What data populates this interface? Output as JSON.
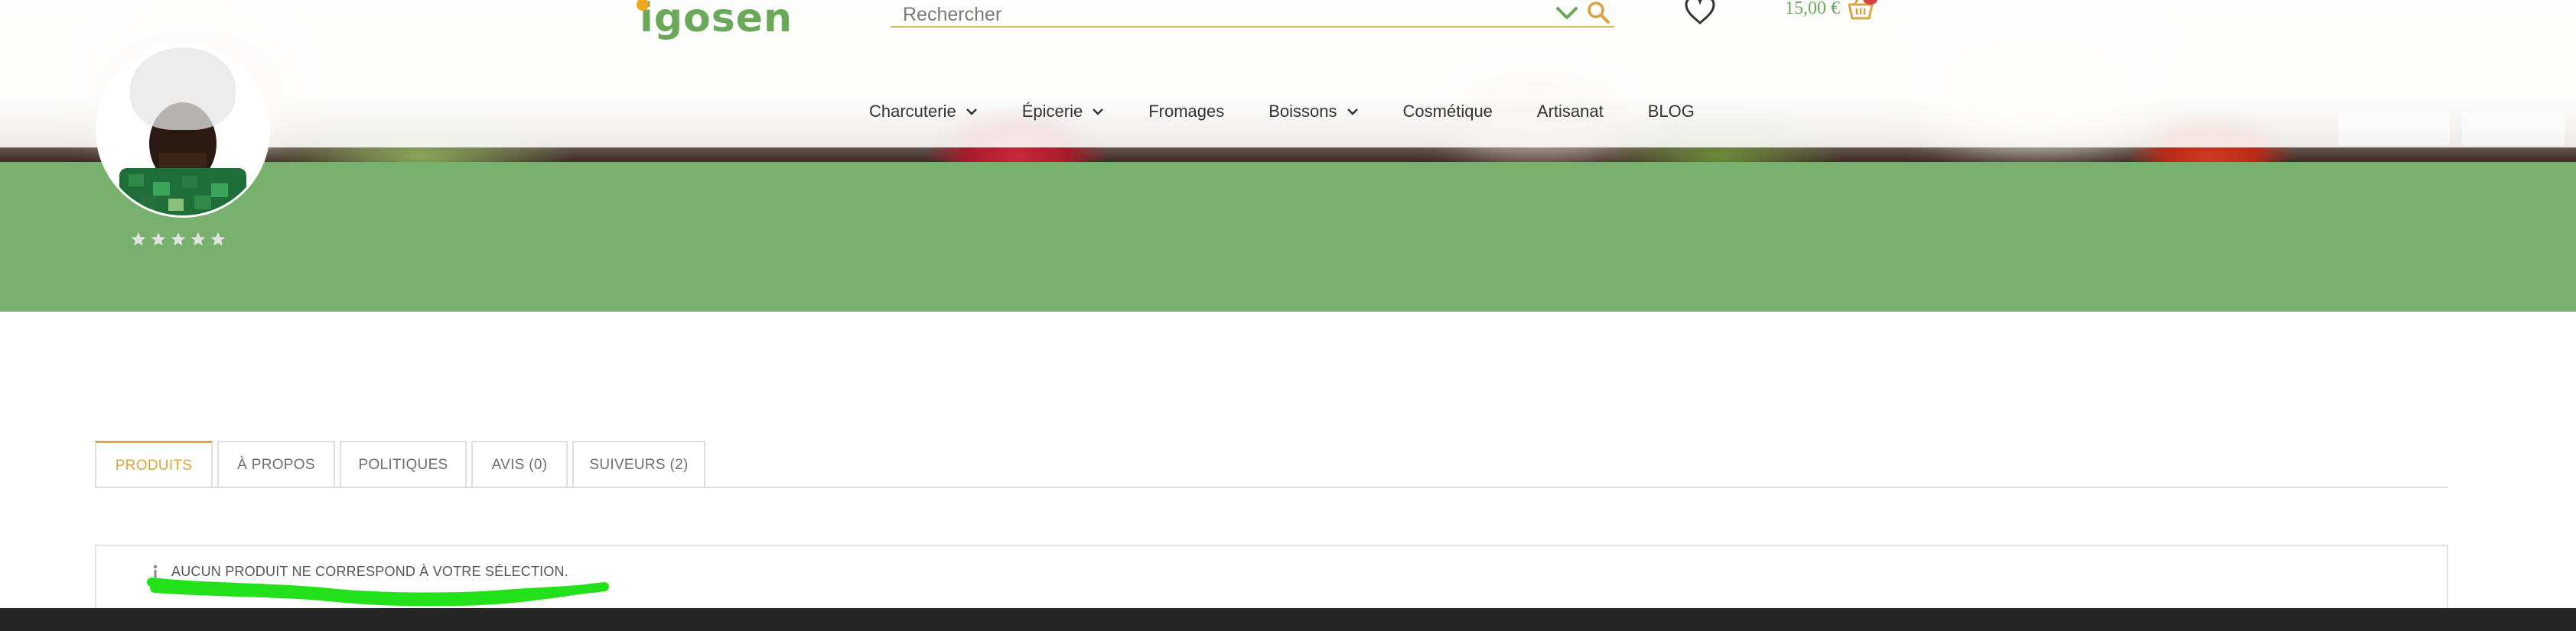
{
  "header": {
    "logo_text": "igosen",
    "search": {
      "placeholder": "Rechercher"
    },
    "cart_total": "15,00 €"
  },
  "nav": {
    "items": [
      {
        "label": "Charcuterie",
        "has_dropdown": true
      },
      {
        "label": "Épicerie",
        "has_dropdown": true
      },
      {
        "label": "Fromages",
        "has_dropdown": false
      },
      {
        "label": "Boissons",
        "has_dropdown": true
      },
      {
        "label": "Cosmétique",
        "has_dropdown": false
      },
      {
        "label": "Artisanat",
        "has_dropdown": false
      },
      {
        "label": "BLOG",
        "has_dropdown": false
      }
    ]
  },
  "store": {
    "rating_stars": 5,
    "rating_value": 0
  },
  "tabs": [
    {
      "label": "PRODUITS",
      "active": true
    },
    {
      "label": "À PROPOS",
      "active": false
    },
    {
      "label": "POLITIQUES",
      "active": false
    },
    {
      "label": "AVIS (0)",
      "active": false
    },
    {
      "label": "SUIVEURS (2)",
      "active": false
    }
  ],
  "notice": {
    "text": "AUCUN PRODUIT NE CORRESPOND À VOTRE SÉLECTION."
  },
  "colors": {
    "brand_green": "#78b06e",
    "accent_gold": "#d9a441",
    "logo_green": "#6aa85a",
    "scribble_green": "#22e01a",
    "footer_dark": "#262626"
  }
}
